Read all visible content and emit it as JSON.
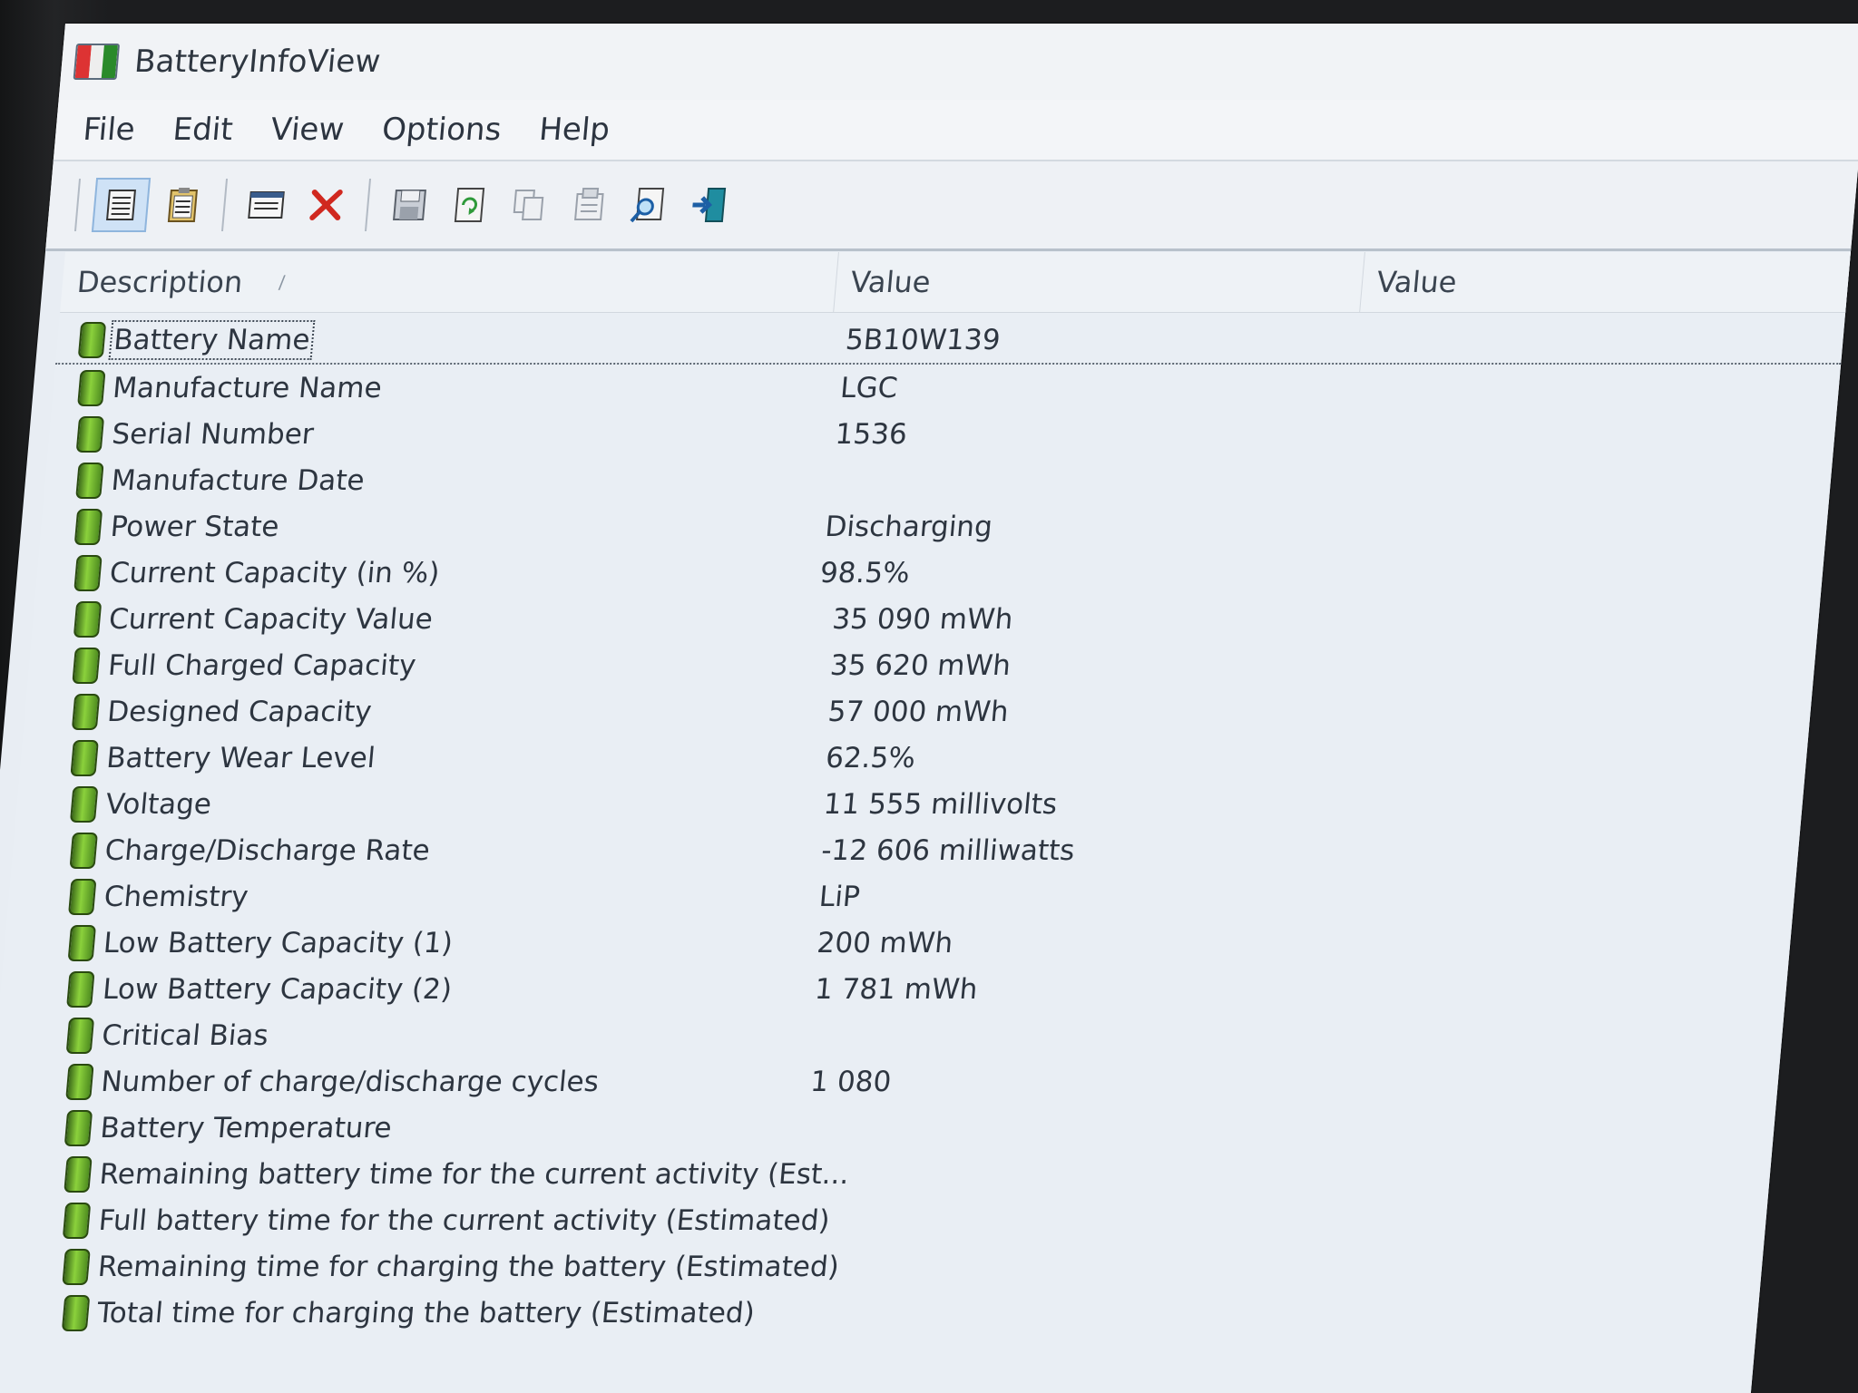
{
  "window": {
    "title": "BatteryInfoView"
  },
  "menu": [
    "File",
    "Edit",
    "View",
    "Options",
    "Help"
  ],
  "toolbar": {
    "buttons": [
      {
        "name": "advanced-mode-icon",
        "active": true
      },
      {
        "name": "clipboard-icon"
      },
      {
        "name": "log-window-icon"
      },
      {
        "name": "delete-icon"
      },
      {
        "name": "save-icon"
      },
      {
        "name": "refresh-icon"
      },
      {
        "name": "copy-icon"
      },
      {
        "name": "properties-icon"
      },
      {
        "name": "find-icon"
      },
      {
        "name": "exit-icon"
      }
    ],
    "accent_delete": "#d0281f"
  },
  "list": {
    "headers": {
      "description": "Description",
      "value1": "Value",
      "value2": "Value"
    },
    "rows": [
      {
        "label": "Battery Name",
        "value": "5B10W139"
      },
      {
        "label": "Manufacture Name",
        "value": "LGC"
      },
      {
        "label": "Serial Number",
        "value": " 1536"
      },
      {
        "label": "Manufacture Date",
        "value": ""
      },
      {
        "label": "Power State",
        "value": "Discharging"
      },
      {
        "label": "Current Capacity (in %)",
        "value": "98.5%"
      },
      {
        "label": "Current Capacity Value",
        "value": "35 090 mWh"
      },
      {
        "label": "Full Charged Capacity",
        "value": "35 620 mWh"
      },
      {
        "label": "Designed Capacity",
        "value": "57 000 mWh"
      },
      {
        "label": "Battery Wear Level",
        "value": "62.5%"
      },
      {
        "label": "Voltage",
        "value": "11 555 millivolts"
      },
      {
        "label": "Charge/Discharge Rate",
        "value": "-12 606 milliwatts"
      },
      {
        "label": "Chemistry",
        "value": "LiP"
      },
      {
        "label": "Low Battery Capacity (1)",
        "value": "200 mWh"
      },
      {
        "label": "Low Battery Capacity (2)",
        "value": "1 781 mWh"
      },
      {
        "label": "Critical Bias",
        "value": ""
      },
      {
        "label": "Number of charge/discharge cycles",
        "value": "1 080"
      },
      {
        "label": "Battery Temperature",
        "value": ""
      },
      {
        "label": "Remaining battery time for the current activity (Est...",
        "value": ""
      },
      {
        "label": "Full battery time for the current activity (Estimated)",
        "value": ""
      },
      {
        "label": "Remaining time for charging the battery (Estimated)",
        "value": ""
      },
      {
        "label": "Total  time for charging the battery (Estimated)",
        "value": ""
      }
    ]
  }
}
